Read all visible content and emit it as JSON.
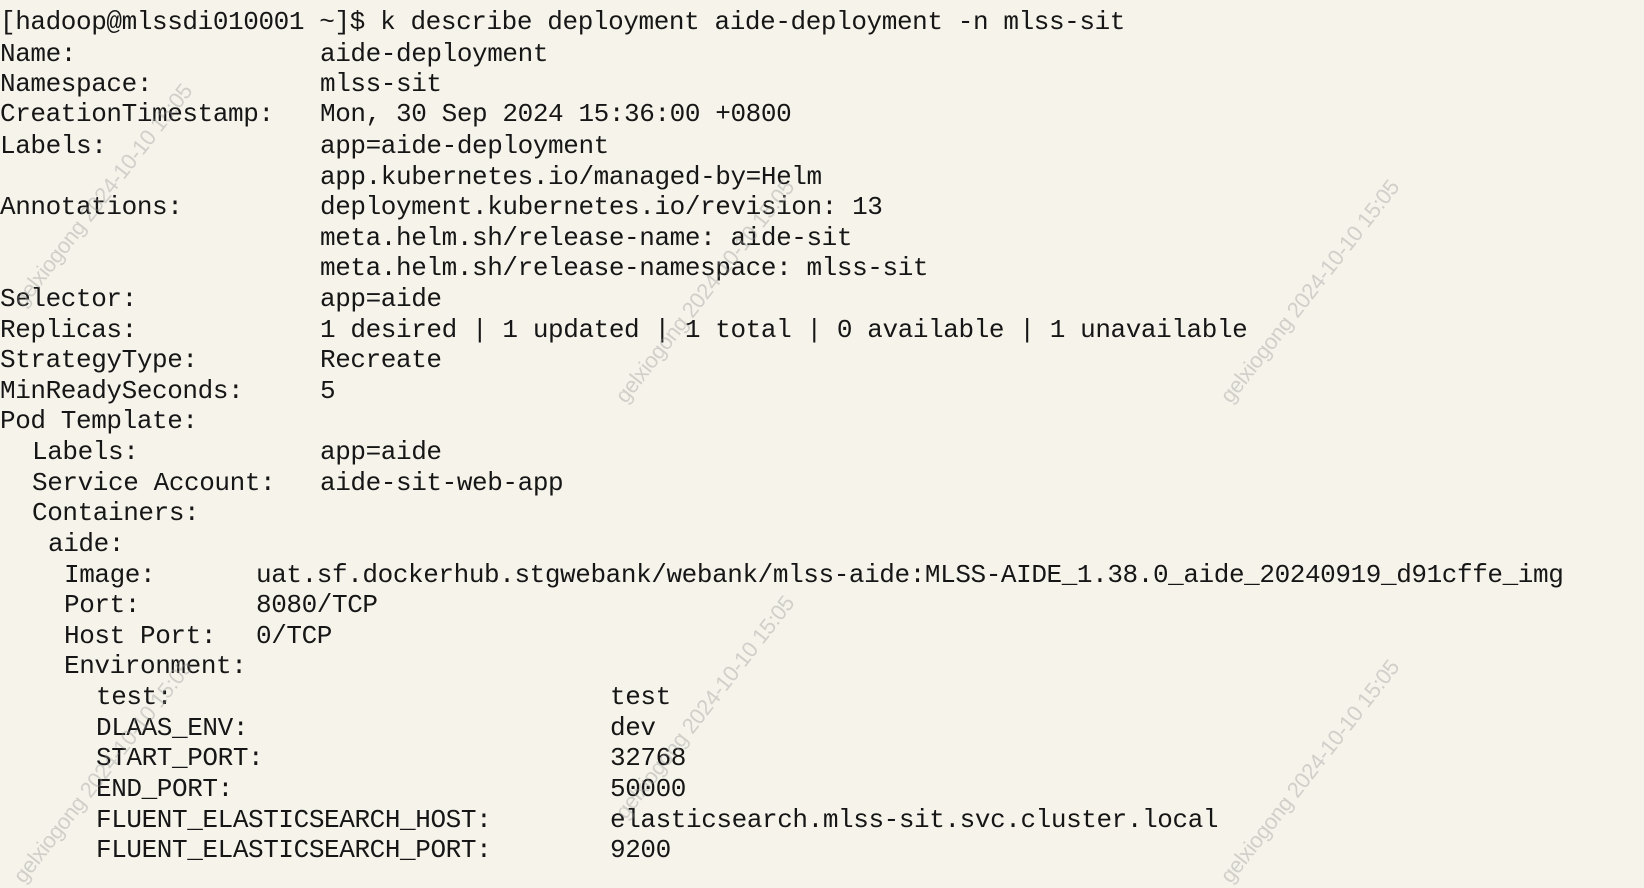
{
  "terminal": {
    "prompt_line": "[hadoop@mlssdi010001 ~]$ k describe deployment aide-deployment -n mlss-sit",
    "fields": {
      "name": {
        "key": "Name:",
        "value": "aide-deployment"
      },
      "namespace": {
        "key": "Namespace:",
        "value": "mlss-sit"
      },
      "creation_timestamp": {
        "key": "CreationTimestamp:",
        "value": "Mon, 30 Sep 2024 15:36:00 +0800"
      },
      "labels": {
        "key": "Labels:",
        "values": [
          "app=aide-deployment",
          "app.kubernetes.io/managed-by=Helm"
        ]
      },
      "annotations": {
        "key": "Annotations:",
        "values": [
          "deployment.kubernetes.io/revision: 13",
          "meta.helm.sh/release-name: aide-sit",
          "meta.helm.sh/release-namespace: mlss-sit"
        ]
      },
      "selector": {
        "key": "Selector:",
        "value": "app=aide"
      },
      "replicas": {
        "key": "Replicas:",
        "value": "1 desired | 1 updated | 1 total | 0 available | 1 unavailable"
      },
      "strategy_type": {
        "key": "StrategyType:",
        "value": "Recreate"
      },
      "min_ready_seconds": {
        "key": "MinReadySeconds:",
        "value": "5"
      },
      "pod_template": {
        "key": "Pod Template:"
      }
    },
    "pod_template": {
      "labels": {
        "key": "Labels:",
        "value": "app=aide"
      },
      "service_account": {
        "key": "Service Account:",
        "value": "aide-sit-web-app"
      },
      "containers": {
        "key": "Containers:"
      },
      "container_name": "aide:",
      "image": {
        "key": "Image:",
        "value": "uat.sf.dockerhub.stgwebank/webank/mlss-aide:MLSS-AIDE_1.38.0_aide_20240919_d91cffe_img"
      },
      "port": {
        "key": "Port:",
        "value": "8080/TCP"
      },
      "host_port": {
        "key": "Host Port:",
        "value": "0/TCP"
      },
      "environment": {
        "key": "Environment:"
      },
      "env": [
        {
          "key": "test:",
          "value": "test"
        },
        {
          "key": "DLAAS_ENV:",
          "value": "dev"
        },
        {
          "key": "START_PORT:",
          "value": "32768"
        },
        {
          "key": "END_PORT:",
          "value": "50000"
        },
        {
          "key": "FLUENT_ELASTICSEARCH_HOST:",
          "value": "elasticsearch.mlss-sit.svc.cluster.local"
        },
        {
          "key": "FLUENT_ELASTICSEARCH_PORT:",
          "value": "9200"
        }
      ]
    }
  },
  "watermark": {
    "text": "gelxiogong 2024-10-10 15:05"
  }
}
